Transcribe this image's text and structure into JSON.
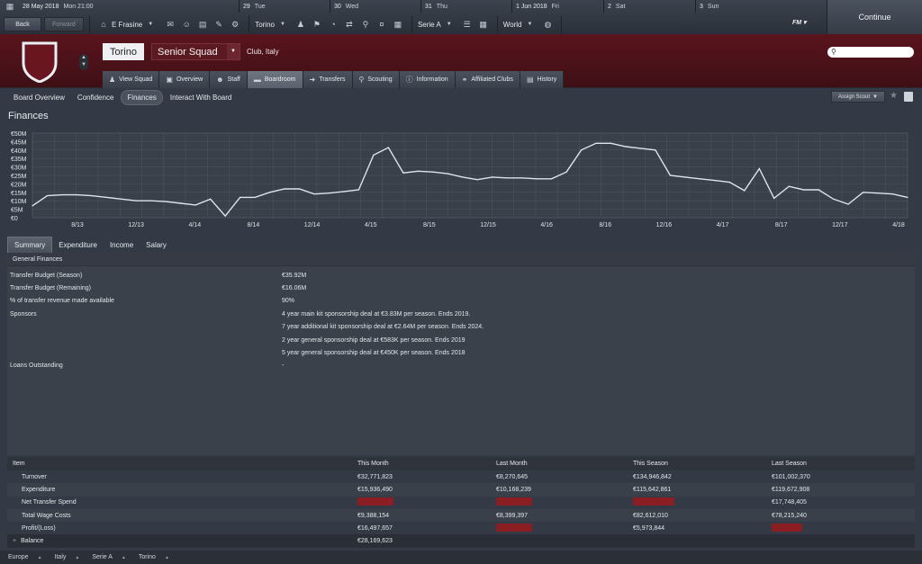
{
  "topbar": {
    "date": "28 May 2018",
    "time": "Mon 21:00",
    "days": [
      {
        "num": "29",
        "name": "Tue"
      },
      {
        "num": "30",
        "name": "Wed"
      },
      {
        "num": "31",
        "name": "Thu"
      },
      {
        "num": "1 Jun 2018",
        "name": "Fri"
      },
      {
        "num": "2",
        "name": "Sat"
      },
      {
        "num": "3",
        "name": "Sun"
      }
    ],
    "back": "Back",
    "forward": "Forward",
    "manager": "E Frasine",
    "club": "Torino",
    "competition": "Serie A",
    "world": "World",
    "fm": "FM",
    "continue": "Continue"
  },
  "header": {
    "club": "Torino",
    "squad": "Senior Squad",
    "info": "Club, Italy"
  },
  "tabs": [
    "View Squad",
    "Overview",
    "Staff",
    "Boardroom",
    "Transfers",
    "Scouting",
    "Information",
    "Affiliated Clubs",
    "History"
  ],
  "subnav": [
    "Board Overview",
    "Confidence",
    "Finances",
    "Interact With Board"
  ],
  "assign_scout": "Assign Scout",
  "page_title": "Finances",
  "chart_data": {
    "type": "line",
    "y_ticks": [
      "€50M",
      "€45M",
      "€40M",
      "€35M",
      "€30M",
      "€25M",
      "€20M",
      "€15M",
      "€10M",
      "€5M",
      "€0"
    ],
    "ylim": [
      0,
      50
    ],
    "x_ticks": [
      "8/13",
      "12/13",
      "4/14",
      "8/14",
      "12/14",
      "4/15",
      "8/15",
      "12/15",
      "4/16",
      "8/16",
      "12/16",
      "4/17",
      "8/17",
      "12/17",
      "4/18"
    ],
    "values": [
      7,
      13,
      13.5,
      13.5,
      13,
      12,
      11,
      10,
      10,
      9.5,
      8.5,
      7.5,
      11,
      1,
      12,
      12,
      15,
      17,
      17,
      14,
      14.5,
      15.5,
      16.5,
      37,
      41.5,
      26.5,
      27.5,
      27,
      26,
      24,
      22.5,
      24,
      23.5,
      23.5,
      23,
      23,
      27,
      40,
      44,
      44,
      42,
      41,
      40,
      25,
      24,
      23,
      22,
      21,
      16,
      29,
      11.5,
      18.5,
      16.5,
      16.5,
      11,
      8,
      15,
      14.5,
      14,
      12
    ]
  },
  "summary_tabs": [
    "Summary",
    "Expenditure",
    "Income",
    "Salary"
  ],
  "general": {
    "title": "General Finances",
    "rows": [
      {
        "label": "Transfer Budget (Season)",
        "value": "€35.92M"
      },
      {
        "label": "Transfer Budget (Remaining)",
        "value": "€16.06M"
      },
      {
        "label": "% of transfer revenue made available",
        "value": "90%"
      },
      {
        "label": "Sponsors",
        "value": "4 year main kit sponsorship deal at €3.83M per season. Ends 2019."
      },
      {
        "label": "",
        "value": "7 year additional kit sponsorship deal at €2.64M per season. Ends 2024."
      },
      {
        "label": "",
        "value": "2 year general sponsorship deal at €583K per season. Ends 2019"
      },
      {
        "label": "",
        "value": "5 year general sponsorship deal at €450K per season. Ends 2018"
      },
      {
        "label": "Loans Outstanding",
        "value": "-"
      }
    ]
  },
  "table": {
    "headers": [
      "Item",
      "This Month",
      "Last Month",
      "This Season",
      "Last Season"
    ],
    "rows": [
      {
        "item": "Turnover",
        "c": [
          "€32,771,823",
          "€8,270,645",
          "€134,946,842",
          "€101,002,370"
        ]
      },
      {
        "item": "Expenditure",
        "c": [
          "€15,936,490",
          "€10,168,239",
          "€115,642,861",
          "€119,672,908"
        ]
      },
      {
        "item": "Net Transfer Spend",
        "c": [
          "",
          "",
          "",
          "€17,748,405"
        ]
      },
      {
        "item": "Total Wage Costs",
        "c": [
          "€9,388,154",
          "€8,399,397",
          "€82,612,010",
          "€78,215,240"
        ]
      },
      {
        "item": "Profit/(Loss)",
        "c": [
          "€16,497,657",
          "",
          "€5,973,844",
          ""
        ]
      },
      {
        "item": "Balance",
        "c": [
          "€28,169,623",
          "",
          "",
          ""
        ]
      }
    ]
  },
  "footer": [
    "Europe",
    "Italy",
    "Serie A",
    "Torino"
  ]
}
